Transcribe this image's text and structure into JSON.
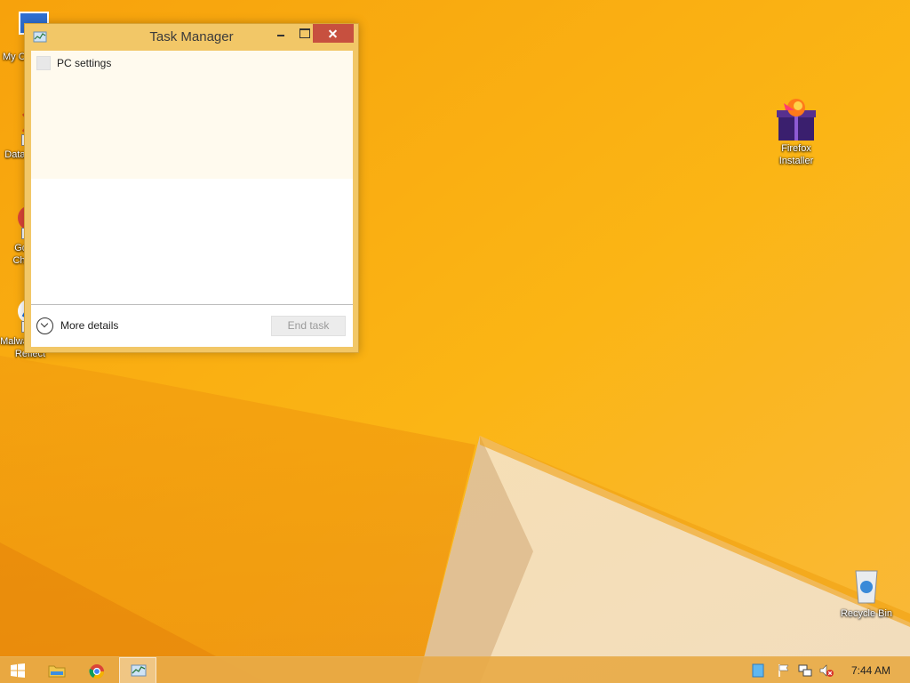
{
  "desktop": {
    "icons": [
      {
        "id": "my-computer",
        "label": "My Computer",
        "icon": "computer-icon"
      },
      {
        "id": "data-folder",
        "label": "Data Folder",
        "icon": "folder-icon"
      },
      {
        "id": "google-chrome",
        "label": "Google Chrome",
        "icon": "chrome-icon"
      },
      {
        "id": "malwarebytes",
        "label": "Malwarebytes Reflect",
        "icon": "malwarebytes-icon"
      },
      {
        "id": "firefox-installer",
        "label": "Firefox\nInstaller",
        "icon": "firefox-icon"
      },
      {
        "id": "recycle-bin",
        "label": "Recycle Bin",
        "icon": "recycle-bin-icon"
      }
    ]
  },
  "task_manager": {
    "title": "Task Manager",
    "processes": [
      {
        "name": "PC settings"
      }
    ],
    "more_details_label": "More details",
    "end_task_label": "End task"
  },
  "taskbar": {
    "pinned": [
      {
        "id": "start",
        "icon": "windows-logo-icon"
      },
      {
        "id": "explorer",
        "icon": "folder-icon"
      },
      {
        "id": "chrome",
        "icon": "chrome-icon"
      },
      {
        "id": "task-manager",
        "icon": "task-manager-icon",
        "active": true
      }
    ],
    "tray": [
      {
        "id": "action-center",
        "icon": "action-center-icon"
      },
      {
        "id": "network",
        "icon": "network-icon"
      },
      {
        "id": "volume",
        "icon": "volume-muted-icon"
      }
    ],
    "clock": "7:44 AM"
  },
  "colors": {
    "wallpaper": "#f6a90f",
    "window_frame": "#f2c767",
    "close_button": "#c7503f"
  }
}
